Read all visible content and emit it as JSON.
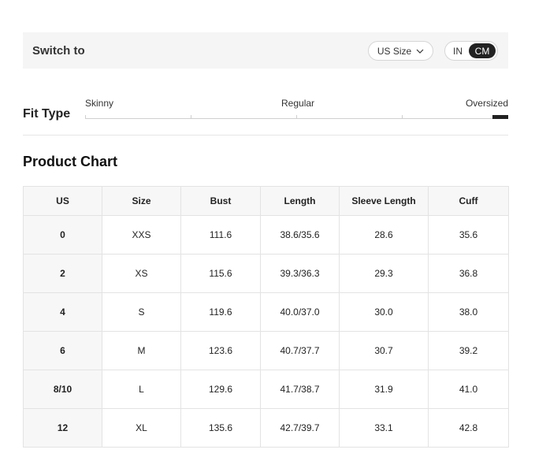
{
  "switch_bar": {
    "label": "Switch to",
    "size_select": {
      "value": "US Size",
      "icon": "chevron-down-icon"
    },
    "unit_toggle": {
      "in_label": "IN",
      "cm_label": "CM",
      "selected": "CM"
    }
  },
  "fit": {
    "title": "Fit Type",
    "labels": {
      "skinny": "Skinny",
      "regular": "Regular",
      "oversized": "Oversized"
    },
    "selected": "Oversized"
  },
  "product_chart": {
    "title": "Product Chart",
    "headers": [
      "US",
      "Size",
      "Bust",
      "Length",
      "Sleeve Length",
      "Cuff"
    ],
    "rows": [
      [
        "0",
        "XXS",
        "111.6",
        "38.6/35.6",
        "28.6",
        "35.6"
      ],
      [
        "2",
        "XS",
        "115.6",
        "39.3/36.3",
        "29.3",
        "36.8"
      ],
      [
        "4",
        "S",
        "119.6",
        "40.0/37.0",
        "30.0",
        "38.0"
      ],
      [
        "6",
        "M",
        "123.6",
        "40.7/37.7",
        "30.7",
        "39.2"
      ],
      [
        "8/10",
        "L",
        "129.6",
        "41.7/38.7",
        "31.9",
        "41.0"
      ],
      [
        "12",
        "XL",
        "135.6",
        "42.7/39.7",
        "33.1",
        "42.8"
      ]
    ]
  }
}
